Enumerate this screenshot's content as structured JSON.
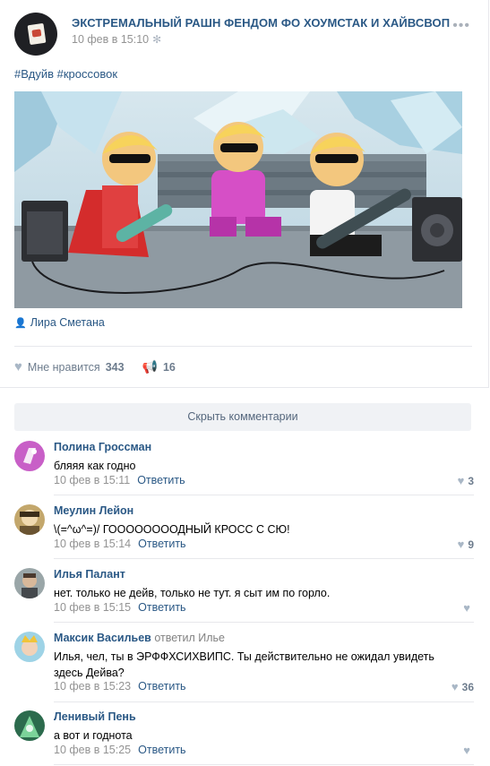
{
  "post": {
    "group_name": "ЭКСТРЕМАЛЬНЫЙ РАШН ФЕНДОМ ФО ХОУМСТАК И ХАЙВСВОП",
    "date": "10 фев в 15:10",
    "more_icon": "more-dots-icon",
    "hashtags": "#Вдуйв #кроссовок",
    "author": "Лира Сметана",
    "likes_label": "Мне нравится",
    "likes_count": "343",
    "shares_count": "16"
  },
  "hide_comments_label": "Скрыть комментарии",
  "reply_label": "Ответить",
  "comments": [
    {
      "name": "Полина Гроссман",
      "text": "бляяя как годно",
      "date": "10 фев в 15:11",
      "likes": "3"
    },
    {
      "name": "Меулин Лейон",
      "text": "\\(=^ω^=)/ ГООООООООДНЫЙ КРОСС С СЮ!",
      "date": "10 фев в 15:14",
      "likes": "9"
    },
    {
      "name": "Илья Палант",
      "text": "нет. только не дейв, только не тут. я сыт им по горло.",
      "date": "10 фев в 15:15",
      "likes": ""
    },
    {
      "name": "Максик Васильев",
      "replied_to": "ответил Илье",
      "text": "Илья, чел, ты в ЭРФФХСИХВИПС. Ты действительно не ожидал увидеть здесь Дейва?",
      "date": "10 фев в 15:23",
      "likes": "36"
    },
    {
      "name": "Ленивый Пень",
      "text": "а вот и годнота",
      "date": "10 фев в 15:25",
      "likes": ""
    }
  ],
  "colors": {
    "link": "#2a5885",
    "muted": "#939393",
    "divider": "#e7e8ec"
  }
}
